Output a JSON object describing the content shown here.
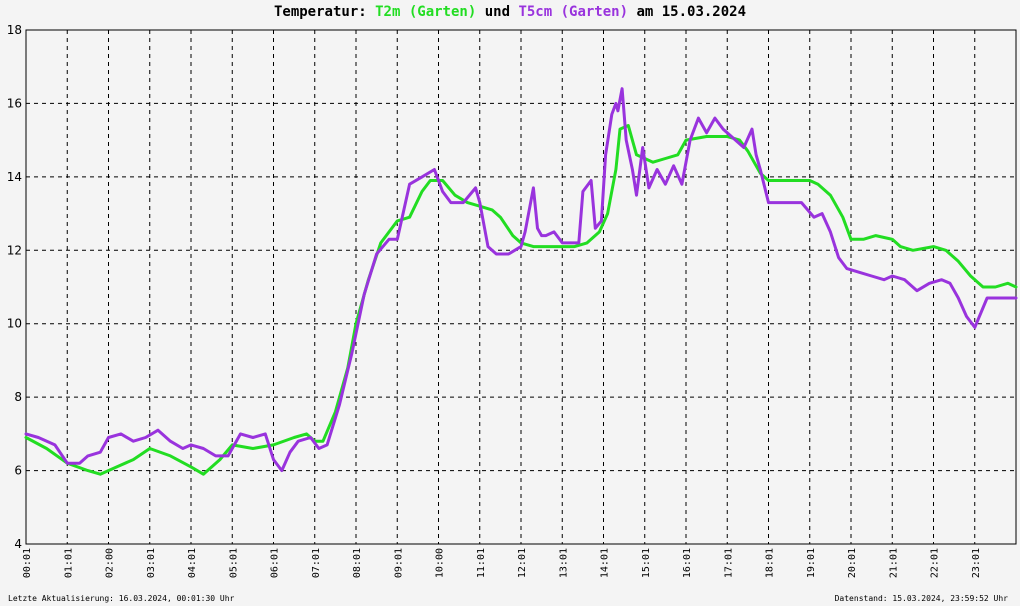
{
  "title": {
    "prefix": "Temperatur: ",
    "series1": "T2m (Garten)",
    "connector": " und ",
    "series2": "T5cm (Garten)",
    "suffix": " am 15.03.2024"
  },
  "footer": {
    "left": "Letzte Aktualisierung: 16.03.2024, 00:01:30 Uhr",
    "right": "Datenstand: 15.03.2024, 23:59:52 Uhr"
  },
  "chart_data": {
    "type": "line",
    "ylim": [
      4,
      18
    ],
    "xlim": [
      0,
      24
    ],
    "yticks": [
      4,
      6,
      8,
      10,
      12,
      14,
      16,
      18
    ],
    "xtick_labels": [
      "00:01",
      "01:01",
      "02:00",
      "03:01",
      "04:01",
      "05:01",
      "06:01",
      "07:01",
      "08:01",
      "09:01",
      "10:00",
      "11:01",
      "12:01",
      "13:01",
      "14:01",
      "15:01",
      "16:01",
      "17:01",
      "18:01",
      "19:01",
      "20:01",
      "21:01",
      "22:01",
      "23:01"
    ],
    "grid": true,
    "colors": {
      "T2m": "#22dd22",
      "T5cm": "#9933dd"
    },
    "series": [
      {
        "name": "T2m (Garten)",
        "x": [
          0,
          0.5,
          1,
          1.5,
          1.8,
          2.2,
          2.6,
          3,
          3.5,
          4,
          4.3,
          4.7,
          5,
          5.5,
          6,
          6.5,
          6.8,
          7,
          7.2,
          7.5,
          7.8,
          8,
          8.3,
          8.6,
          9,
          9.3,
          9.6,
          9.8,
          10.1,
          10.4,
          10.7,
          11,
          11.3,
          11.5,
          11.8,
          12,
          12.3,
          12.7,
          13,
          13.3,
          13.6,
          13.9,
          14.1,
          14.3,
          14.4,
          14.6,
          14.8,
          15.2,
          15.5,
          15.8,
          16,
          16.5,
          17,
          17.3,
          17.5,
          17.8,
          18,
          18.3,
          19,
          19.2,
          19.5,
          19.8,
          20,
          20.3,
          20.6,
          21,
          21.2,
          21.5,
          22,
          22.3,
          22.6,
          22.9,
          23.2,
          23.5,
          23.8,
          24
        ],
        "values": [
          6.9,
          6.6,
          6.2,
          6.0,
          5.9,
          6.1,
          6.3,
          6.6,
          6.4,
          6.1,
          5.9,
          6.3,
          6.7,
          6.6,
          6.7,
          6.9,
          7.0,
          6.8,
          6.8,
          7.6,
          8.8,
          10.0,
          11.2,
          12.2,
          12.8,
          12.9,
          13.6,
          13.9,
          13.9,
          13.5,
          13.3,
          13.2,
          13.1,
          12.9,
          12.4,
          12.2,
          12.1,
          12.1,
          12.1,
          12.1,
          12.2,
          12.5,
          13.0,
          14.2,
          15.3,
          15.4,
          14.6,
          14.4,
          14.5,
          14.6,
          15.0,
          15.1,
          15.1,
          15.0,
          14.7,
          14.1,
          13.9,
          13.9,
          13.9,
          13.8,
          13.5,
          12.9,
          12.3,
          12.3,
          12.4,
          12.3,
          12.1,
          12.0,
          12.1,
          12.0,
          11.7,
          11.3,
          11.0,
          11.0,
          11.1,
          11.0
        ]
      },
      {
        "name": "T5cm (Garten)",
        "x": [
          0,
          0.3,
          0.7,
          1,
          1.3,
          1.5,
          1.8,
          2,
          2.3,
          2.6,
          2.9,
          3.2,
          3.5,
          3.8,
          4,
          4.3,
          4.6,
          4.9,
          5.2,
          5.5,
          5.8,
          6,
          6.2,
          6.4,
          6.6,
          6.9,
          7.1,
          7.3,
          7.6,
          7.9,
          8.2,
          8.5,
          8.8,
          9,
          9.3,
          9.6,
          9.9,
          10.1,
          10.3,
          10.6,
          10.9,
          11,
          11.2,
          11.4,
          11.5,
          11.7,
          12,
          12.1,
          12.3,
          12.4,
          12.5,
          12.6,
          12.8,
          13,
          13.2,
          13.4,
          13.5,
          13.7,
          13.8,
          13.95,
          14.05,
          14.2,
          14.3,
          14.35,
          14.45,
          14.55,
          14.7,
          14.8,
          14.95,
          15.1,
          15.3,
          15.5,
          15.7,
          15.9,
          16.1,
          16.3,
          16.5,
          16.7,
          16.9,
          17.2,
          17.4,
          17.6,
          17.7,
          17.8,
          18,
          18.2,
          18.5,
          18.8,
          19.1,
          19.3,
          19.5,
          19.7,
          19.9,
          20.2,
          20.5,
          20.8,
          21,
          21.3,
          21.6,
          21.9,
          22.2,
          22.4,
          22.6,
          22.8,
          23,
          23.3,
          23.6,
          23.9,
          24
        ],
        "values": [
          7.0,
          6.9,
          6.7,
          6.2,
          6.2,
          6.4,
          6.5,
          6.9,
          7.0,
          6.8,
          6.9,
          7.1,
          6.8,
          6.6,
          6.7,
          6.6,
          6.4,
          6.4,
          7.0,
          6.9,
          7.0,
          6.3,
          6.0,
          6.5,
          6.8,
          6.9,
          6.6,
          6.7,
          7.8,
          9.2,
          10.8,
          11.9,
          12.3,
          12.3,
          13.8,
          14.0,
          14.2,
          13.6,
          13.3,
          13.3,
          13.7,
          13.3,
          12.1,
          11.9,
          11.9,
          11.9,
          12.1,
          12.5,
          13.7,
          12.6,
          12.4,
          12.4,
          12.5,
          12.2,
          12.2,
          12.2,
          13.6,
          13.9,
          12.6,
          12.8,
          14.6,
          15.7,
          16.0,
          15.8,
          16.4,
          15.0,
          14.2,
          13.5,
          14.8,
          13.7,
          14.2,
          13.8,
          14.3,
          13.8,
          15.0,
          15.6,
          15.2,
          15.6,
          15.3,
          15.0,
          14.8,
          15.3,
          14.6,
          14.2,
          13.3,
          13.3,
          13.3,
          13.3,
          12.9,
          13.0,
          12.5,
          11.8,
          11.5,
          11.4,
          11.3,
          11.2,
          11.3,
          11.2,
          10.9,
          11.1,
          11.2,
          11.1,
          10.7,
          10.2,
          9.9,
          10.7,
          10.7,
          10.7,
          10.7
        ]
      }
    ]
  }
}
